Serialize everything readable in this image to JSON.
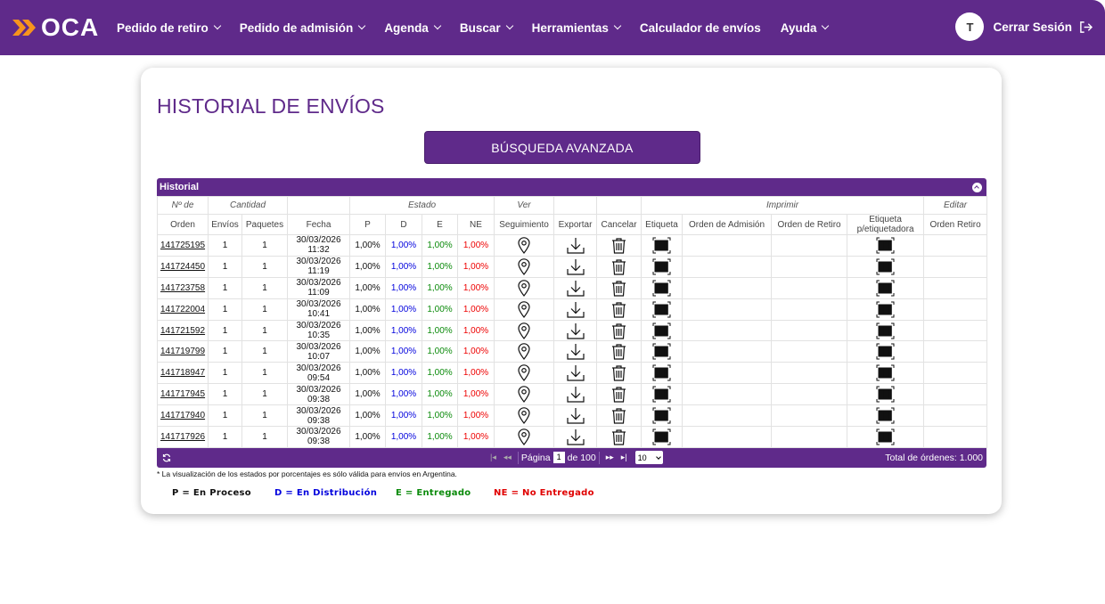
{
  "nav": {
    "logo": "OCA",
    "items": [
      {
        "label": "Pedido de retiro",
        "dropdown": true
      },
      {
        "label": "Pedido de admisión",
        "dropdown": true
      },
      {
        "label": "Agenda",
        "dropdown": true
      },
      {
        "label": "Buscar",
        "dropdown": true
      },
      {
        "label": "Herramientas",
        "dropdown": true
      },
      {
        "label": "Calculador de envíos",
        "dropdown": false
      },
      {
        "label": "Ayuda",
        "dropdown": true
      }
    ],
    "user_initial": "T",
    "logout_label": "Cerrar Sesión"
  },
  "page": {
    "title": "HISTORIAL DE ENVÍOS",
    "advanced_search_label": "BÚSQUEDA AVANZADA"
  },
  "grid": {
    "caption": "Historial",
    "group_headers": [
      "Nº de",
      "Cantidad",
      "",
      "Estado",
      "Ver",
      "",
      "",
      "Imprimir",
      "Editar"
    ],
    "columns": [
      "Orden",
      "Envíos",
      "Paquetes",
      "Fecha",
      "P",
      "D",
      "E",
      "NE",
      "Seguimiento",
      "Exportar",
      "Cancelar",
      "Etiqueta",
      "Orden de Admisión",
      "Orden de Retiro",
      "Etiqueta p/etiquetadora",
      "Orden Retiro"
    ],
    "rows": [
      {
        "orden": "141725195",
        "envios": "1",
        "paquetes": "1",
        "fecha": "30/03/2026",
        "hora": "11:32",
        "p": "1,00%",
        "d": "1,00%",
        "e": "1,00%",
        "ne": "1,00%"
      },
      {
        "orden": "141724450",
        "envios": "1",
        "paquetes": "1",
        "fecha": "30/03/2026",
        "hora": "11:19",
        "p": "1,00%",
        "d": "1,00%",
        "e": "1,00%",
        "ne": "1,00%"
      },
      {
        "orden": "141723758",
        "envios": "1",
        "paquetes": "1",
        "fecha": "30/03/2026",
        "hora": "11:09",
        "p": "1,00%",
        "d": "1,00%",
        "e": "1,00%",
        "ne": "1,00%"
      },
      {
        "orden": "141722004",
        "envios": "1",
        "paquetes": "1",
        "fecha": "30/03/2026",
        "hora": "10:41",
        "p": "1,00%",
        "d": "1,00%",
        "e": "1,00%",
        "ne": "1,00%"
      },
      {
        "orden": "141721592",
        "envios": "1",
        "paquetes": "1",
        "fecha": "30/03/2026",
        "hora": "10:35",
        "p": "1,00%",
        "d": "1,00%",
        "e": "1,00%",
        "ne": "1,00%"
      },
      {
        "orden": "141719799",
        "envios": "1",
        "paquetes": "1",
        "fecha": "30/03/2026",
        "hora": "10:07",
        "p": "1,00%",
        "d": "1,00%",
        "e": "1,00%",
        "ne": "1,00%"
      },
      {
        "orden": "141718947",
        "envios": "1",
        "paquetes": "1",
        "fecha": "30/03/2026",
        "hora": "09:54",
        "p": "1,00%",
        "d": "1,00%",
        "e": "1,00%",
        "ne": "1,00%"
      },
      {
        "orden": "141717945",
        "envios": "1",
        "paquetes": "1",
        "fecha": "30/03/2026",
        "hora": "09:38",
        "p": "1,00%",
        "d": "1,00%",
        "e": "1,00%",
        "ne": "1,00%"
      },
      {
        "orden": "141717940",
        "envios": "1",
        "paquetes": "1",
        "fecha": "30/03/2026",
        "hora": "09:38",
        "p": "1,00%",
        "d": "1,00%",
        "e": "1,00%",
        "ne": "1,00%"
      },
      {
        "orden": "141717926",
        "envios": "1",
        "paquetes": "1",
        "fecha": "30/03/2026",
        "hora": "09:38",
        "p": "1,00%",
        "d": "1,00%",
        "e": "1,00%",
        "ne": "1,00%"
      }
    ],
    "pager": {
      "page_label": "Página",
      "current_page": "1",
      "of_label": "de 100",
      "page_size": "10",
      "total_label": "Total de órdenes: 1.000"
    }
  },
  "note": "* La visualización de los estados por porcentajes es sólo válida para envíos en Argentina.",
  "legend": [
    {
      "text": "P = En Proceso",
      "color": "#111111"
    },
    {
      "text": "D = En Distribución",
      "color": "#0000dd"
    },
    {
      "text": "E = Entregado",
      "color": "#0a8a0a"
    },
    {
      "text": "NE = No Entregado",
      "color": "#e00000"
    }
  ],
  "colors": {
    "brand": "#5f2a8a",
    "accent": "#f7941d"
  }
}
